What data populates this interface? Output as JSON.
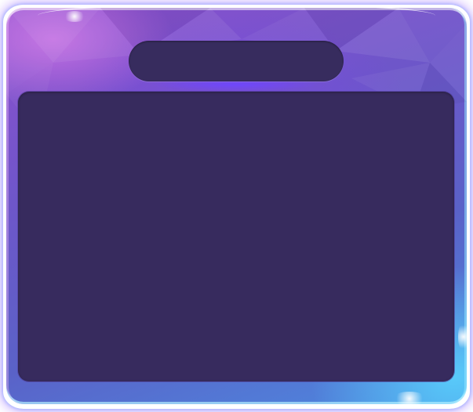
{
  "dialog": {
    "title": "",
    "content": ""
  },
  "theme": {
    "frame_purple": "#8e4fd0",
    "frame_blue": "#4c8be0",
    "panel_dark": "#372b5e",
    "pill_dark": "#372c5e",
    "glow_cyan": "#5ad7ff"
  }
}
